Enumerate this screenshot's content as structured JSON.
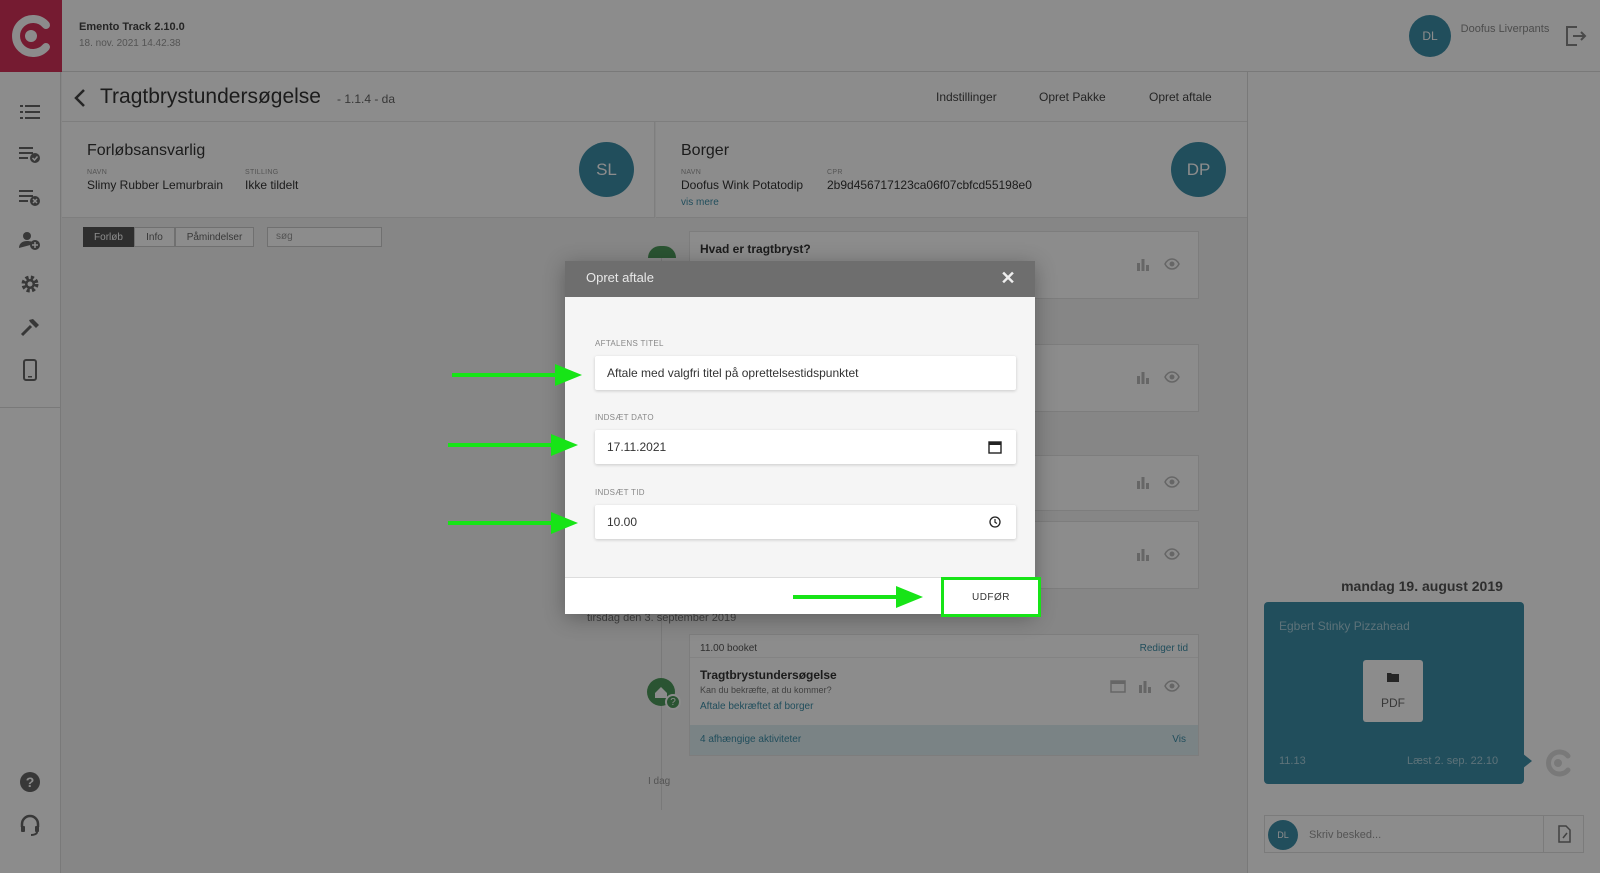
{
  "app": {
    "title": "Emento Track 2.10.0",
    "timestamp": "18. nov. 2021 14.42.38"
  },
  "user": {
    "initials": "DL",
    "name": "Doofus Liverpants"
  },
  "sidebar": {
    "items": [
      "list-icon",
      "list-check-icon",
      "list-remove-icon",
      "person-add-icon",
      "gear-icon",
      "hammer-icon",
      "phone-icon"
    ],
    "bottom": [
      "help-icon",
      "headset-icon"
    ]
  },
  "header": {
    "title": "Tragtbrystundersøgelse",
    "version": "- 1.1.4 - da",
    "links": [
      "Indstillinger",
      "Opret Pakke",
      "Opret aftale"
    ]
  },
  "responsible": {
    "heading": "Forløbsansvarlig",
    "name_label": "NAVN",
    "name": "Slimy Rubber Lemurbrain",
    "role_label": "STILLING",
    "role": "Ikke tildelt",
    "initials": "SL"
  },
  "citizen": {
    "heading": "Borger",
    "name_label": "NAVN",
    "name": "Doofus Wink Potatodip",
    "cpr_label": "CPR",
    "cpr": "2b9d456717123ca06f07cbfcd55198e0",
    "more": "vis mere",
    "initials": "DP"
  },
  "filters": {
    "tabs": [
      "Forløb",
      "Info",
      "Påmindelser"
    ],
    "search_placeholder": "søg"
  },
  "timeline": {
    "first_card_title": "Hvad er tragtbryst?",
    "date_label": "tirsdag den 3. september 2019",
    "appointment": {
      "booked": "11.00 booket",
      "edit": "Rediger tid",
      "title": "Tragtbrystundersøgelse",
      "question": "Kan du bekræfte, at du kommer?",
      "status": "Aftale bekræftet af borger",
      "dependents": "4 afhængige aktiviteter",
      "view": "Vis"
    },
    "today": "I dag"
  },
  "chat": {
    "date": "mandag 19. august 2019",
    "sender": "Egbert Stinky Pizzahead",
    "attachment": "PDF",
    "time": "11.13",
    "read": "Læst 2. sep. 22.10",
    "avatar": "DL",
    "placeholder": "Skriv besked..."
  },
  "modal": {
    "title": "Opret aftale",
    "close": "✕",
    "title_label": "AFTALENS TITEL",
    "title_value": "Aftale med valgfri titel på oprettelsestidspunktet",
    "date_label": "INDSÆT DATO",
    "date_value": "17.11.2021",
    "time_label": "INDSÆT TID",
    "time_value": "10.00",
    "submit": "UDFØR"
  },
  "colors": {
    "brand": "#d6325a",
    "accent": "#3d8ea8",
    "success": "#4e9a5c",
    "highlight": "#17e417"
  }
}
